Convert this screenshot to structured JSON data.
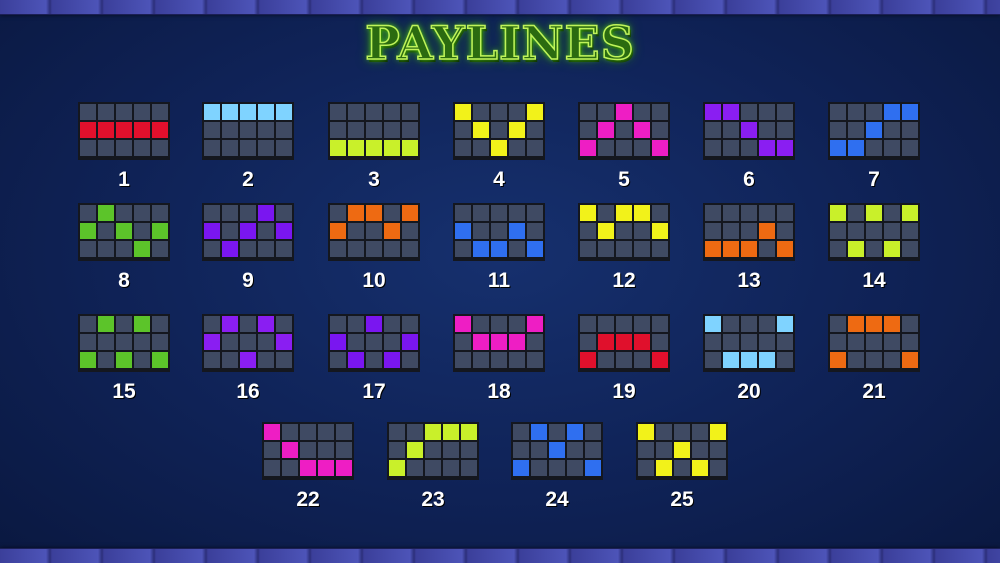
{
  "title": "PAYLINES",
  "paylines": [
    {
      "number": "1",
      "color": "#e0102c",
      "cells": [
        [
          1,
          0
        ],
        [
          1,
          1
        ],
        [
          1,
          2
        ],
        [
          1,
          3
        ],
        [
          1,
          4
        ]
      ]
    },
    {
      "number": "2",
      "color": "#7fd3ff",
      "cells": [
        [
          0,
          0
        ],
        [
          0,
          1
        ],
        [
          0,
          2
        ],
        [
          0,
          3
        ],
        [
          0,
          4
        ]
      ]
    },
    {
      "number": "3",
      "color": "#c9f02a",
      "cells": [
        [
          2,
          0
        ],
        [
          2,
          1
        ],
        [
          2,
          2
        ],
        [
          2,
          3
        ],
        [
          2,
          4
        ]
      ]
    },
    {
      "number": "4",
      "color": "#f2f21a",
      "cells": [
        [
          0,
          0
        ],
        [
          1,
          1
        ],
        [
          2,
          2
        ],
        [
          1,
          3
        ],
        [
          0,
          4
        ]
      ]
    },
    {
      "number": "5",
      "color": "#ee1ec4",
      "cells": [
        [
          2,
          0
        ],
        [
          1,
          1
        ],
        [
          0,
          2
        ],
        [
          1,
          3
        ],
        [
          2,
          4
        ]
      ]
    },
    {
      "number": "6",
      "color": "#8a1ef2",
      "cells": [
        [
          0,
          0
        ],
        [
          0,
          1
        ],
        [
          1,
          2
        ],
        [
          2,
          3
        ],
        [
          2,
          4
        ]
      ]
    },
    {
      "number": "7",
      "color": "#2f6ff0",
      "cells": [
        [
          2,
          0
        ],
        [
          2,
          1
        ],
        [
          1,
          2
        ],
        [
          0,
          3
        ],
        [
          0,
          4
        ]
      ]
    },
    {
      "number": "8",
      "color": "#5cc42a",
      "cells": [
        [
          1,
          0
        ],
        [
          0,
          1
        ],
        [
          1,
          2
        ],
        [
          2,
          3
        ],
        [
          1,
          4
        ]
      ]
    },
    {
      "number": "9",
      "color": "#7a16f0",
      "cells": [
        [
          1,
          0
        ],
        [
          2,
          1
        ],
        [
          1,
          2
        ],
        [
          0,
          3
        ],
        [
          1,
          4
        ]
      ]
    },
    {
      "number": "10",
      "color": "#ee6a12",
      "cells": [
        [
          1,
          0
        ],
        [
          0,
          1
        ],
        [
          0,
          2
        ],
        [
          1,
          3
        ],
        [
          0,
          4
        ]
      ]
    },
    {
      "number": "11",
      "color": "#2f6ff0",
      "cells": [
        [
          1,
          0
        ],
        [
          2,
          1
        ],
        [
          2,
          2
        ],
        [
          1,
          3
        ],
        [
          2,
          4
        ]
      ]
    },
    {
      "number": "12",
      "color": "#f2f21a",
      "cells": [
        [
          0,
          0
        ],
        [
          1,
          1
        ],
        [
          0,
          2
        ],
        [
          0,
          3
        ],
        [
          1,
          4
        ]
      ]
    },
    {
      "number": "13",
      "color": "#ee6a12",
      "cells": [
        [
          2,
          0
        ],
        [
          2,
          1
        ],
        [
          2,
          2
        ],
        [
          1,
          3
        ],
        [
          2,
          4
        ]
      ]
    },
    {
      "number": "14",
      "color": "#c9f02a",
      "cells": [
        [
          0,
          0
        ],
        [
          2,
          1
        ],
        [
          0,
          2
        ],
        [
          2,
          3
        ],
        [
          0,
          4
        ]
      ]
    },
    {
      "number": "15",
      "color": "#5cc42a",
      "cells": [
        [
          2,
          0
        ],
        [
          0,
          1
        ],
        [
          2,
          2
        ],
        [
          0,
          3
        ],
        [
          2,
          4
        ]
      ]
    },
    {
      "number": "16",
      "color": "#8a1ef2",
      "cells": [
        [
          1,
          0
        ],
        [
          0,
          1
        ],
        [
          2,
          2
        ],
        [
          0,
          3
        ],
        [
          1,
          4
        ]
      ]
    },
    {
      "number": "17",
      "color": "#7a16f0",
      "cells": [
        [
          1,
          0
        ],
        [
          2,
          1
        ],
        [
          0,
          2
        ],
        [
          2,
          3
        ],
        [
          1,
          4
        ]
      ]
    },
    {
      "number": "18",
      "color": "#ee1ec4",
      "cells": [
        [
          0,
          0
        ],
        [
          1,
          1
        ],
        [
          1,
          2
        ],
        [
          1,
          3
        ],
        [
          0,
          4
        ]
      ]
    },
    {
      "number": "19",
      "color": "#e0102c",
      "cells": [
        [
          2,
          0
        ],
        [
          1,
          1
        ],
        [
          1,
          2
        ],
        [
          1,
          3
        ],
        [
          2,
          4
        ]
      ]
    },
    {
      "number": "20",
      "color": "#7fd3ff",
      "cells": [
        [
          0,
          0
        ],
        [
          2,
          1
        ],
        [
          2,
          2
        ],
        [
          2,
          3
        ],
        [
          0,
          4
        ]
      ]
    },
    {
      "number": "21",
      "color": "#ee6a12",
      "cells": [
        [
          2,
          0
        ],
        [
          0,
          1
        ],
        [
          0,
          2
        ],
        [
          0,
          3
        ],
        [
          2,
          4
        ]
      ]
    },
    {
      "number": "22",
      "color": "#ee1ec4",
      "cells": [
        [
          0,
          0
        ],
        [
          1,
          1
        ],
        [
          2,
          2
        ],
        [
          2,
          3
        ],
        [
          2,
          4
        ]
      ]
    },
    {
      "number": "23",
      "color": "#c9f02a",
      "cells": [
        [
          2,
          0
        ],
        [
          1,
          1
        ],
        [
          0,
          2
        ],
        [
          0,
          3
        ],
        [
          0,
          4
        ]
      ]
    },
    {
      "number": "24",
      "color": "#2f6ff0",
      "cells": [
        [
          2,
          0
        ],
        [
          0,
          1
        ],
        [
          1,
          2
        ],
        [
          0,
          3
        ],
        [
          2,
          4
        ]
      ]
    },
    {
      "number": "25",
      "color": "#f2f21a",
      "cells": [
        [
          0,
          0
        ],
        [
          2,
          1
        ],
        [
          1,
          2
        ],
        [
          2,
          3
        ],
        [
          0,
          4
        ]
      ]
    }
  ]
}
